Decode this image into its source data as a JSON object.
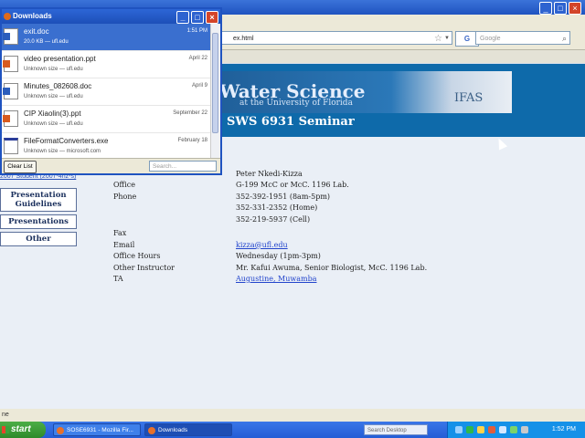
{
  "browser": {
    "url_partial": "ex.html",
    "search_engine_label": "G",
    "search_placeholder": "Google",
    "status_text": "ne"
  },
  "page": {
    "banner_title": "Water Science",
    "banner_subtitle": "at the University of Florida",
    "banner_logo": "IFAS",
    "course_title": "SWS 6931 Seminar",
    "nav_link_small": "2007 Student (2007-4hz-s)",
    "nav_buttons": [
      "Presentation Guidelines",
      "Presentations",
      "Other"
    ],
    "info": {
      "instructor_value": "Peter Nkedi-Kizza",
      "office_label": "Office",
      "office_value": "G-199 McC   or McC. 1196 Lab.",
      "phone_label": "Phone",
      "phone_values": [
        "352-392-1951 (8am-5pm)",
        "352-331-2352 (Home)",
        "352-219-5937 (Cell)"
      ],
      "fax_label": "Fax",
      "email_label": "Email",
      "email_value": "kizza@ufl.edu",
      "hours_label": "Office Hours",
      "hours_value": "Wednesday (1pm-3pm)",
      "other_label": "Other Instructor",
      "other_value": "Mr. Kafui Awuma, Senior Biologist, McC. 1196 Lab.",
      "ta_label": "TA",
      "ta_value": "Augustine, Muwamba"
    }
  },
  "downloads": {
    "title": "Downloads",
    "items": [
      {
        "name": "exit.doc",
        "meta": "20.0 KB — ufl.edu",
        "date": "1:51 PM",
        "type": "doc"
      },
      {
        "name": "video presentation.ppt",
        "meta": "Unknown size — ufl.edu",
        "date": "April 22",
        "type": "ppt"
      },
      {
        "name": "Minutes_082608.doc",
        "meta": "Unknown size — ufl.edu",
        "date": "April 9",
        "type": "doc"
      },
      {
        "name": "CIP Xiaolin(3).ppt",
        "meta": "Unknown size — ufl.edu",
        "date": "September 22",
        "type": "ppt"
      },
      {
        "name": "FileFormatConverters.exe",
        "meta": "Unknown size — microsoft.com",
        "date": "February 18",
        "type": "exe"
      }
    ],
    "clear_label": "Clear List",
    "search_placeholder": "Search..."
  },
  "taskbar": {
    "start_label": "start",
    "tasks": [
      "SOSE6931 - Mozilla Fir...",
      "Downloads"
    ],
    "desktop_search_placeholder": "Search Desktop",
    "clock": "1:52 PM"
  }
}
